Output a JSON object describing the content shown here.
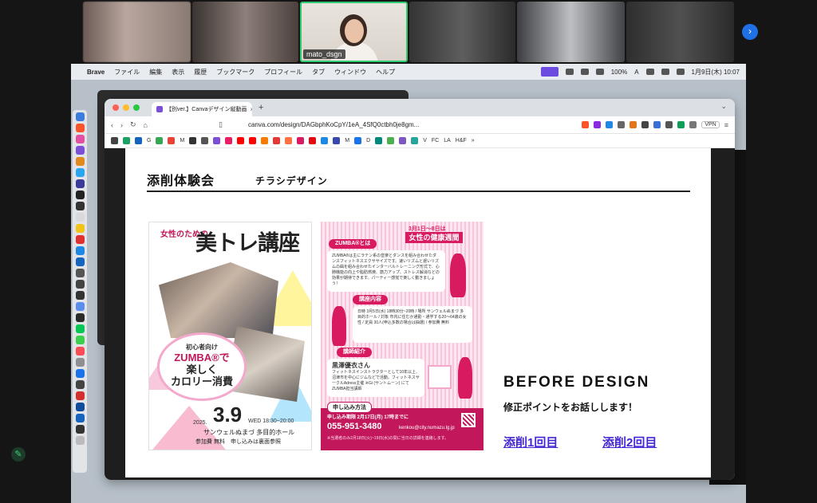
{
  "meeting": {
    "participants": [
      {
        "name": ""
      },
      {
        "name": ""
      },
      {
        "name": "mato_dsgn",
        "active": true
      },
      {
        "name": ""
      },
      {
        "name": ""
      },
      {
        "name": ""
      }
    ],
    "next_label": "›"
  },
  "mac_menubar": {
    "items": [
      "Brave",
      "ファイル",
      "編集",
      "表示",
      "履歴",
      "ブックマーク",
      "プロフィール",
      "タブ",
      "ウィンドウ",
      "ヘルプ"
    ],
    "battery": "100%",
    "keyboard": "A",
    "clock": "1月9日(木) 10:07"
  },
  "browser": {
    "tab_title": "【別ver.】Canvaデザイン縦動画",
    "tab_close": "×",
    "new_tab": "+",
    "url": "canva.com/design/DAGbphKoCpY/1eA_4SfQ0ctbh0je8gm...",
    "vpn_label": "VPN",
    "bookmarks": [
      "G",
      "M",
      "M",
      "D",
      "V",
      "FC",
      "LA",
      "H&F"
    ],
    "more": "»"
  },
  "slide": {
    "title": "添削体験会",
    "subtitle": "チラシデザイン",
    "before_heading": "BEFORE DESIGN",
    "before_sub": "修正ポイントをお話しします！",
    "link1": "添削1回目",
    "link2": "添削2回目"
  },
  "flyer1": {
    "title_small": "女性のための",
    "title_main": "美トレ講座",
    "circle_line1": "初心者向け",
    "circle_line2": "ZUMBA®で",
    "circle_line3": "楽しく",
    "circle_line4": "カロリー消費",
    "date": "3.9",
    "year": "2025.",
    "time": "WED 18:30~20:00",
    "venue": "サンウェルぬまづ 多目的ホール",
    "fee": "参加費 無料　申し込みは裏面参照"
  },
  "flyer2": {
    "header": "3月1日～8日は",
    "band": "女性の健康週間",
    "pill1": "ZUMBA®とは",
    "box1": "ZUMBA®は主にラテン系の音楽とダンスを組み合わせたダンスフィットネスエクササイズです。速いリズムと遅いリズムの曲を組み合わせたインターバルトレーニング形式で、心肺機能の向上や脂肪燃焼、筋力アップ、ストレス解消などの効果が期待できます。パーティー感覚で楽しく動きましょう！",
    "pill2": "講座内容",
    "box2": "日時 3月5日(水) 18時30分~20時 / 場所 サンウェルぬまづ 多目的ホール / 対象 市内に住むか通勤・通学する20～64歳の女性 / 定員 30人(申込多数の場合は抽選) / 参加費 無料",
    "pill3": "講師紹介",
    "instructor": "黒澤優衣さん",
    "box3": "フィットネスインストラクターとして10年以上、沼津市を中心にジムなどで活動。フィットネスサークルAdress主催 ※Gi (サントムーン) にてZUMBA担当講師",
    "apply": "申し込み方法",
    "deadline": "申し込み期限 2月17日(月) 17時までに",
    "phone": "055-951-3480",
    "email": "kenkou@city.numazu.lg.jp",
    "notice": "※当選者のみ2月18日(火)~19日(水)の間に当日の詳細を連絡します。"
  },
  "colors": {
    "accent_pink": "#d81b60",
    "link_purple": "#4527d6",
    "active_speaker": "#2ecc71"
  }
}
